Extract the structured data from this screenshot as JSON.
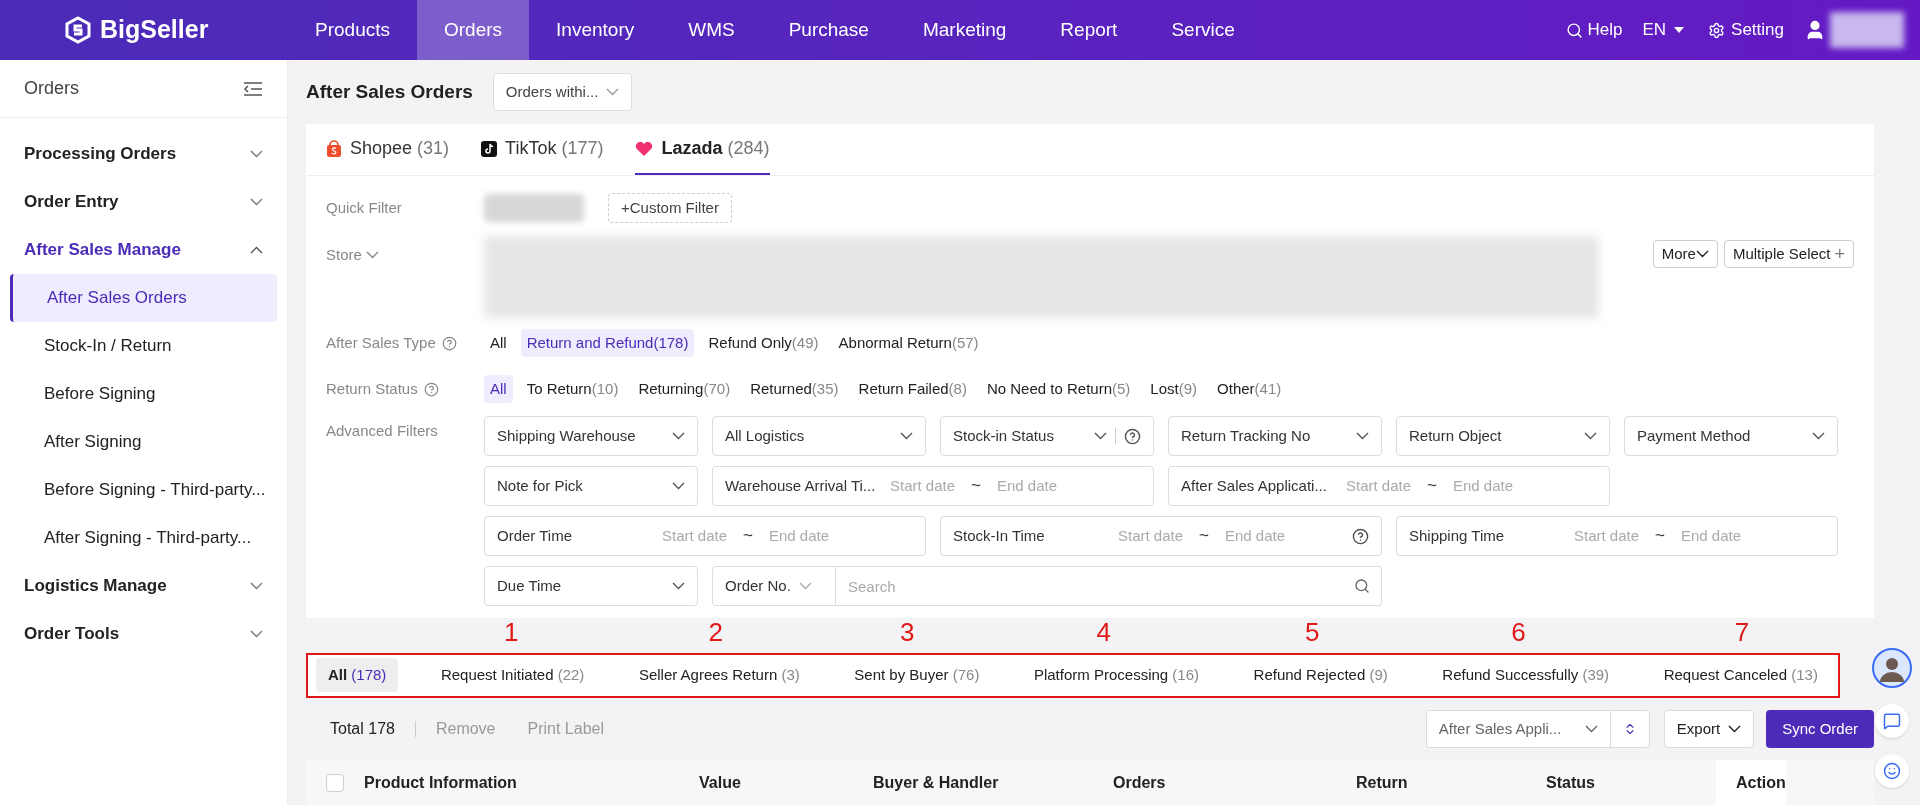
{
  "nav": {
    "logo": "BigSeller",
    "items": [
      {
        "label": "Products",
        "selected": false
      },
      {
        "label": "Orders",
        "selected": true
      },
      {
        "label": "Inventory",
        "selected": false
      },
      {
        "label": "WMS",
        "selected": false
      },
      {
        "label": "Purchase",
        "selected": false
      },
      {
        "label": "Marketing",
        "selected": false
      },
      {
        "label": "Report",
        "selected": false
      },
      {
        "label": "Service",
        "selected": false
      }
    ],
    "help": "Help",
    "language": "EN",
    "setting": "Setting"
  },
  "sidebar": {
    "title": "Orders",
    "groups": [
      {
        "label": "Processing Orders",
        "expanded": false
      },
      {
        "label": "Order Entry",
        "expanded": false
      },
      {
        "label": "After Sales Manage",
        "expanded": true,
        "children": [
          {
            "label": "After Sales Orders",
            "selected": true
          },
          {
            "label": "Stock-In / Return",
            "selected": false
          },
          {
            "label": "Before Signing",
            "selected": false
          },
          {
            "label": "After Signing",
            "selected": false
          },
          {
            "label": "Before Signing - Third-party...",
            "selected": false
          },
          {
            "label": "After Signing - Third-party...",
            "selected": false
          }
        ]
      },
      {
        "label": "Logistics Manage",
        "expanded": false
      },
      {
        "label": "Order Tools",
        "expanded": false
      }
    ]
  },
  "page": {
    "title": "After Sales Orders",
    "range": "Orders withi..."
  },
  "platform_tabs": [
    {
      "kind": "shopee",
      "label": "Shopee",
      "count": "(31)",
      "selected": false
    },
    {
      "kind": "tiktok",
      "label": "TikTok",
      "count": "(177)",
      "selected": false
    },
    {
      "kind": "lazada",
      "label": "Lazada",
      "count": "(284)",
      "selected": true
    }
  ],
  "filters": {
    "quick_filter_label": "Quick Filter",
    "custom_filter": "+Custom Filter",
    "store_label": "Store",
    "more": "More",
    "multiple_select": "Multiple Select",
    "multiple_select_plus": "+",
    "after_sales_type": {
      "label": "After Sales Type",
      "options": [
        {
          "label": "All",
          "selected": false
        },
        {
          "label": "Return and Refund",
          "count": "(178)",
          "selected": true
        },
        {
          "label": "Refund Only",
          "count": "(49)",
          "selected": false
        },
        {
          "label": "Abnormal Return",
          "count": "(57)",
          "selected": false
        }
      ]
    },
    "return_status": {
      "label": "Return Status",
      "options": [
        {
          "label": "All",
          "selected": true
        },
        {
          "label": "To Return",
          "count": "(10)",
          "selected": false
        },
        {
          "label": "Returning",
          "count": "(70)",
          "selected": false
        },
        {
          "label": "Returned",
          "count": "(35)",
          "selected": false
        },
        {
          "label": "Return Failed",
          "count": "(8)",
          "selected": false
        },
        {
          "label": "No Need to Return",
          "count": "(5)",
          "selected": false
        },
        {
          "label": "Lost",
          "count": "(9)",
          "selected": false
        },
        {
          "label": "Other",
          "count": "(41)",
          "selected": false
        }
      ]
    },
    "advanced_label": "Advanced Filters",
    "field_lines": [
      {
        "fields": [
          {
            "kind": "select",
            "label": "Shipping Warehouse"
          },
          {
            "kind": "select",
            "label": "All Logistics"
          },
          {
            "kind": "select_help",
            "label": "Stock-in Status"
          },
          {
            "kind": "select",
            "label": "Return Tracking No"
          },
          {
            "kind": "select",
            "label": "Return Object"
          },
          {
            "kind": "select",
            "label": "Payment Method"
          }
        ]
      },
      {
        "fields": [
          {
            "kind": "select",
            "label": "Note for Pick"
          },
          {
            "kind": "range",
            "label": "Warehouse Arrival Ti...",
            "start": "Start date",
            "separator": "~",
            "end": "End date"
          },
          {
            "kind": "range",
            "label": "After Sales Applicati...",
            "start": "Start date",
            "separator": "~",
            "end": "End date"
          }
        ]
      },
      {
        "fields": [
          {
            "kind": "range",
            "label": "Order Time",
            "start": "Start date",
            "separator": "~",
            "end": "End date"
          },
          {
            "kind": "range_help",
            "label": "Stock-In Time",
            "start": "Start date",
            "separator": "~",
            "end": "End date"
          },
          {
            "kind": "range",
            "label": "Shipping Time",
            "start": "Start date",
            "separator": "~",
            "end": "End date"
          }
        ]
      },
      {
        "fields": [
          {
            "kind": "select",
            "label": "Due Time"
          },
          {
            "kind": "search",
            "label": "Order No.",
            "placeholder": "Search"
          }
        ]
      }
    ]
  },
  "annotation_numbers": [
    "1",
    "2",
    "3",
    "4",
    "5",
    "6",
    "7"
  ],
  "status_tabs": [
    {
      "label": "All",
      "count": "(178)",
      "selected": true
    },
    {
      "label": "Request Initiated",
      "count": "(22)",
      "selected": false
    },
    {
      "label": "Seller Agrees Return",
      "count": "(3)",
      "selected": false
    },
    {
      "label": "Sent by Buyer",
      "count": "(76)",
      "selected": false
    },
    {
      "label": "Platform Processing",
      "count": "(16)",
      "selected": false
    },
    {
      "label": "Refund Rejected",
      "count": "(9)",
      "selected": false
    },
    {
      "label": "Refund Successfully",
      "count": "(39)",
      "selected": false
    },
    {
      "label": "Request Canceled",
      "count": "(13)",
      "selected": false
    }
  ],
  "toolbar": {
    "total": "Total 178",
    "remove": "Remove",
    "print_label": "Print Label",
    "sort": "After Sales Appli...",
    "export": "Export",
    "sync": "Sync Order"
  },
  "table": {
    "select_all_checked": false,
    "columns": [
      "Product Information",
      "Value",
      "Buyer & Handler",
      "Orders",
      "Return",
      "Status",
      "Action"
    ]
  }
}
